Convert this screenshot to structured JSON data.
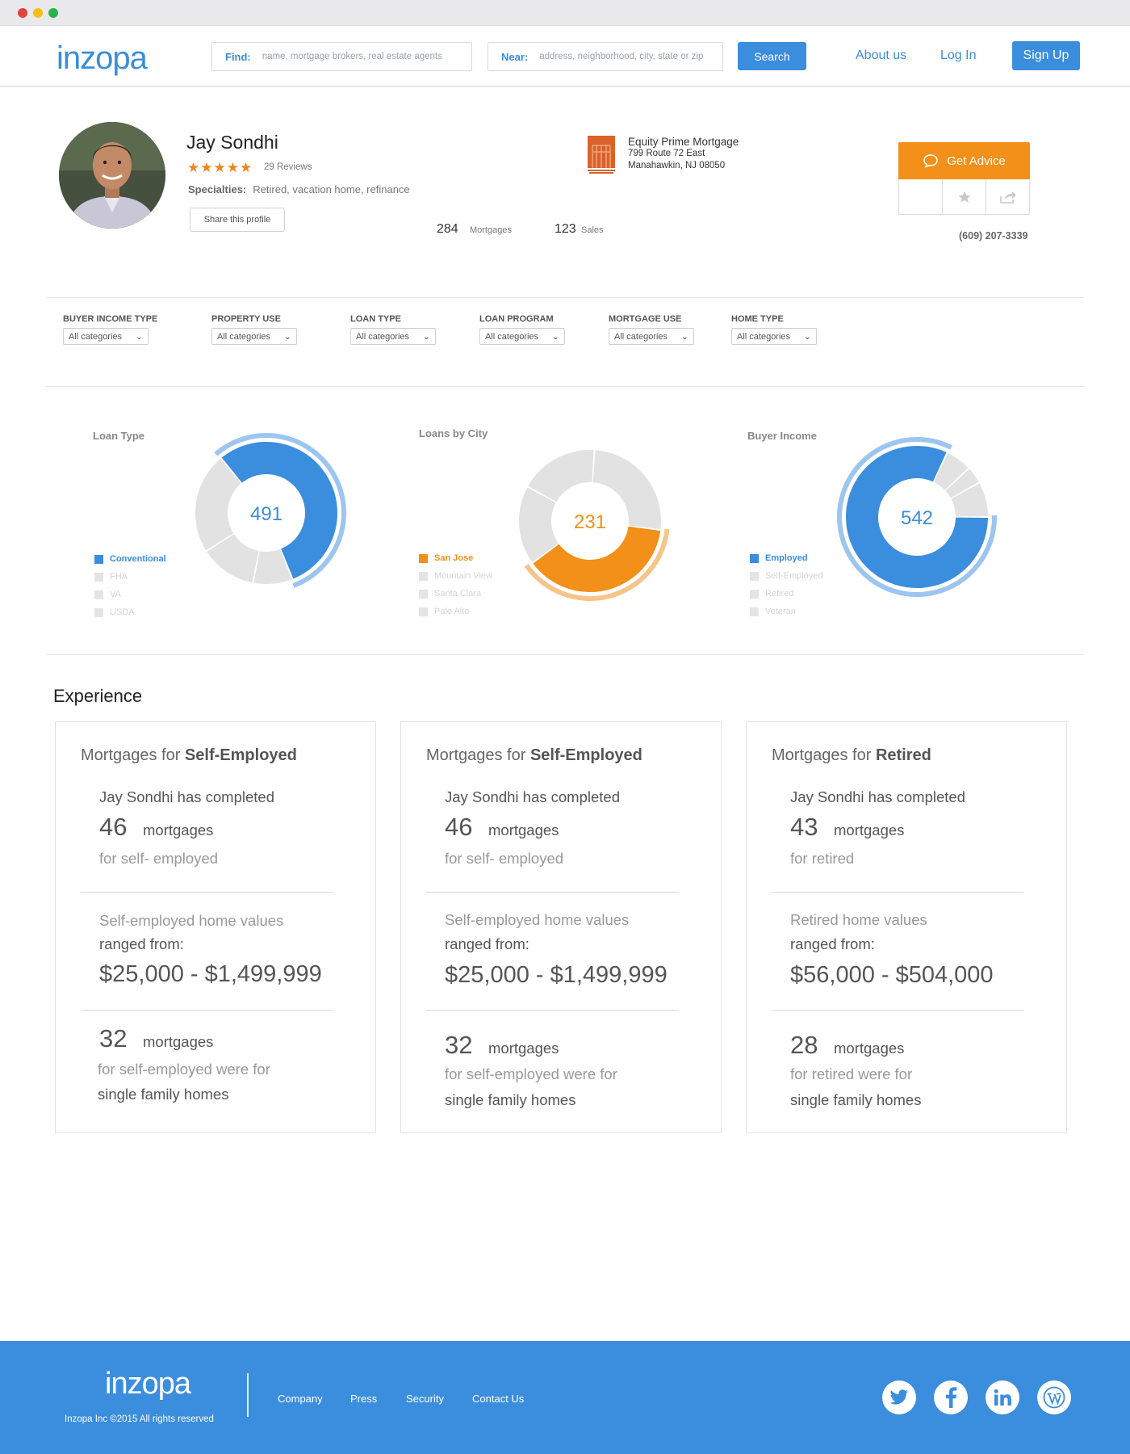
{
  "header": {
    "logo": "inzopa",
    "find_label": "Find:",
    "find_placeholder": "name, mortgage brokers, real estate agents",
    "near_label": "Near:",
    "near_placeholder": "address, neighborhood, city, state or zip",
    "search_button": "Search",
    "about": "About us",
    "login": "Log In",
    "signup": "Sign Up"
  },
  "profile": {
    "name": "Jay Sondhi",
    "stars": "★★★★★",
    "reviews": "29 Reviews",
    "specialties_label": "Specialties:",
    "specialties": "Retired, vacation home, refinance",
    "share_button": "Share this profile",
    "company_name": "Equity Prime Mortgage",
    "company_address1": "799 Route 72 East",
    "company_address2": "Manahawkin, NJ 08050",
    "mortgages_count": "284",
    "mortgages_label": "Mortgages",
    "sales_count": "123",
    "sales_label": "Sales",
    "advice_button": "Get Advice",
    "phone": "(609) 207-3339"
  },
  "filters": [
    {
      "title": "BUYER INCOME TYPE",
      "value": "All categories"
    },
    {
      "title": "PROPERTY USE",
      "value": "All categories"
    },
    {
      "title": "LOAN TYPE",
      "value": "All categories"
    },
    {
      "title": "LOAN PROGRAM",
      "value": "All categories"
    },
    {
      "title": "MORTGAGE USE",
      "value": "All categories"
    },
    {
      "title": "HOME TYPE",
      "value": "All categories"
    }
  ],
  "chart_data": [
    {
      "type": "pie",
      "title": "Loan Type",
      "center_value": "491",
      "categories": [
        "Conventional",
        "FHA",
        "VA",
        "USDA"
      ],
      "values": [
        55,
        9,
        13,
        23
      ],
      "highlight": "Conventional",
      "color": "#3b8ddd"
    },
    {
      "type": "pie",
      "title": "Loans by City",
      "center_value": "231",
      "categories": [
        "San Jose",
        "Mountain View",
        "Santa Clara",
        "Palo Alto"
      ],
      "values": [
        38,
        18,
        18,
        26
      ],
      "highlight": "San Jose",
      "color": "#f39019"
    },
    {
      "type": "pie",
      "title": "Buyer Income",
      "center_value": "542",
      "categories": [
        "Employed",
        "Self-Employed",
        "Retired",
        "Veteran"
      ],
      "values": [
        82,
        6,
        4,
        8
      ],
      "highlight": "Employed",
      "color": "#3b8ddd"
    }
  ],
  "experience": {
    "title": "Experience",
    "cards": [
      {
        "prefix": "Mortgages for",
        "group": "Self-Employed",
        "completed": "Jay Sondhi has completed",
        "count": "46",
        "unit": "mortgages",
        "for_text": "for self- employed",
        "values_text": "Self-employed home values",
        "ranged": "ranged from:",
        "range": "$25,000 - $1,499,999",
        "count2": "32",
        "unit2": "mortgages",
        "were_for": "for self-employed were for",
        "home_type": "single family homes"
      },
      {
        "prefix": "Mortgages for",
        "group": "Self-Employed",
        "completed": "Jay Sondhi has completed",
        "count": "46",
        "unit": "mortgages",
        "for_text": "for self- employed",
        "values_text": "Self-employed home values",
        "ranged": "ranged from:",
        "range": "$25,000 - $1,499,999",
        "count2": "32",
        "unit2": "mortgages",
        "were_for": "for self-employed were for",
        "home_type": "single family homes"
      },
      {
        "prefix": "Mortgages for",
        "group": "Retired",
        "completed": "Jay Sondhi has completed",
        "count": "43",
        "unit": "mortgages",
        "for_text": "for retired",
        "values_text": "Retired home values",
        "ranged": "ranged from:",
        "range": "$56,000 - $504,000",
        "count2": "28",
        "unit2": "mortgages",
        "were_for": "for retired were for",
        "home_type": "single family homes"
      }
    ]
  },
  "footer": {
    "logo": "inzopa",
    "copyright": "Inzopa Inc ©2015 All rights reserved",
    "links": [
      "Company",
      "Press",
      "Security",
      "Contact Us"
    ],
    "social": [
      "twitter-icon",
      "facebook-icon",
      "linkedin-icon",
      "wordpress-icon"
    ]
  }
}
